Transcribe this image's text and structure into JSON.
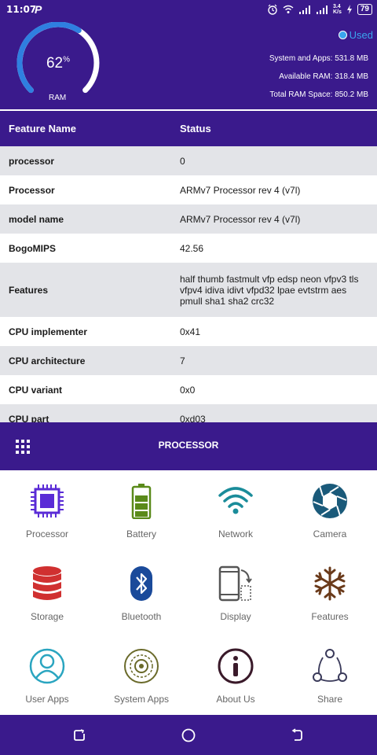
{
  "status_bar": {
    "time": "11:07",
    "app_badge": "P",
    "speed": "3.4\nK/s",
    "battery": "79"
  },
  "ram": {
    "percent": "62",
    "percent_sign": "%",
    "label": "RAM",
    "fraction": 0.62
  },
  "legend": {
    "label": "Used"
  },
  "memory": [
    {
      "text": "System and Apps:  531.8 MB"
    },
    {
      "text": "Available RAM:  318.4 MB"
    },
    {
      "text": "Total RAM Space:  850.2 MB"
    }
  ],
  "table": {
    "col1": "Feature Name",
    "col2": "Status",
    "rows": [
      {
        "name": "processor",
        "status": "0"
      },
      {
        "name": "Processor",
        "status": "ARMv7 Processor rev 4 (v7l)"
      },
      {
        "name": "model name",
        "status": "ARMv7 Processor rev 4 (v7l)"
      },
      {
        "name": "BogoMIPS",
        "status": "42.56"
      },
      {
        "name": "Features",
        "status": "half thumb fastmult vfp edsp neon vfpv3 tls vfpv4 idiva idivt vfpd32 lpae evtstrm aes pmull sha1 sha2 crc32"
      },
      {
        "name": "CPU implementer",
        "status": "0x41"
      },
      {
        "name": "CPU architecture",
        "status": "7"
      },
      {
        "name": "CPU variant",
        "status": "0x0"
      },
      {
        "name": "CPU part",
        "status": "0xd03"
      }
    ]
  },
  "section": {
    "title": "PROCESSOR"
  },
  "tiles": [
    {
      "label": "Processor",
      "icon": "processor-icon",
      "color": "#5a2bd6"
    },
    {
      "label": "Battery",
      "icon": "battery-icon",
      "color": "#5a8a1a"
    },
    {
      "label": "Network",
      "icon": "wifi-icon",
      "color": "#1a8c9a"
    },
    {
      "label": "Camera",
      "icon": "camera-aperture-icon",
      "color": "#1a5a7a"
    },
    {
      "label": "Storage",
      "icon": "database-icon",
      "color": "#d03030"
    },
    {
      "label": "Bluetooth",
      "icon": "bluetooth-icon",
      "color": "#1a4a9a"
    },
    {
      "label": "Display",
      "icon": "display-rotate-icon",
      "color": "#555555"
    },
    {
      "label": "Features",
      "icon": "snowflake-icon",
      "color": "#6a3a1a"
    },
    {
      "label": "User Apps",
      "icon": "user-icon",
      "color": "#2aa5c0"
    },
    {
      "label": "System Apps",
      "icon": "system-apps-icon",
      "color": "#6a6a2a"
    },
    {
      "label": "About Us",
      "icon": "info-icon",
      "color": "#3a1a2a"
    },
    {
      "label": "Share",
      "icon": "share-icon",
      "color": "#3a3a5a"
    }
  ],
  "colors": {
    "primary": "#3a1a8c",
    "accent": "#3aa5ee",
    "row_alt": "#e3e4e8"
  }
}
